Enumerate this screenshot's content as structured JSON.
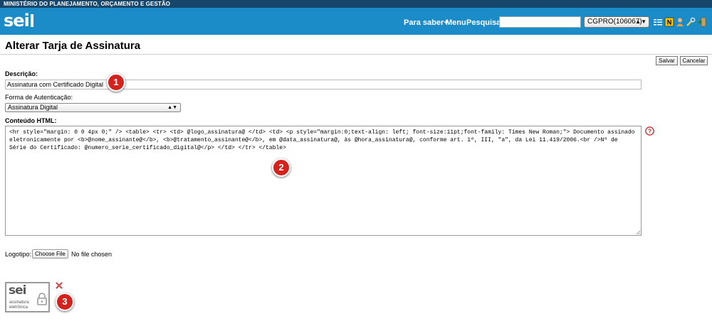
{
  "ministry": "MINISTÉRIO DO PLANEJAMENTO, ORÇAMENTO E GESTÃO",
  "header": {
    "logo": "sei",
    "links": {
      "saber": "Para saber+",
      "menu": "Menu",
      "pesquisa": "Pesquisa"
    },
    "search": {
      "value": "",
      "placeholder": ""
    },
    "unit": "CGPRO(106067)",
    "icons": [
      "list-icon",
      "notification-icon",
      "user-icon",
      "tools-icon",
      "exit-icon"
    ],
    "accent": "#1c8cc9",
    "top_bar_color": "#17466b"
  },
  "page": {
    "title": "Alterar Tarja de Assinatura",
    "save_label": "Salvar",
    "cancel_label": "Cancelar"
  },
  "form": {
    "descricao_label": "Descrição:",
    "descricao_value": "Assinatura com Certificado Digital",
    "auth_label": "Forma de Autenticação:",
    "auth_value": "Assinatura Digital",
    "html_label": "Conteúdo HTML:",
    "html_value": "<hr style=\"margin: 0 0 4px 0;\" />  <table>    <tr>      <td>  @logo_assinatura@      </td>      <td>  <p style=\"margin:0;text-align: left; font-size:11pt;font-family: Times New Roman;\">  Documento assinado eletronicamente por <b>@nome_assinante@</b>, <b>@tratamento_assinante@</b>, em @data_assinatura@, às @hora_assinatura@, conforme art. 1º, III, \"a\", da Lei 11.419/2006.<br />Nº de Série do Certificado: @numero_serie_certificado_digital@</p>      </td>    </tr>  </table>",
    "logo_label": "Logotipo:",
    "file_button": "Choose File",
    "file_status": "No file chosen"
  },
  "seal": {
    "brand": "sei",
    "line1": "assinatura",
    "line2": "eletrônica"
  },
  "callouts": [
    "1",
    "2",
    "3"
  ],
  "callout_color": "#d6221c"
}
